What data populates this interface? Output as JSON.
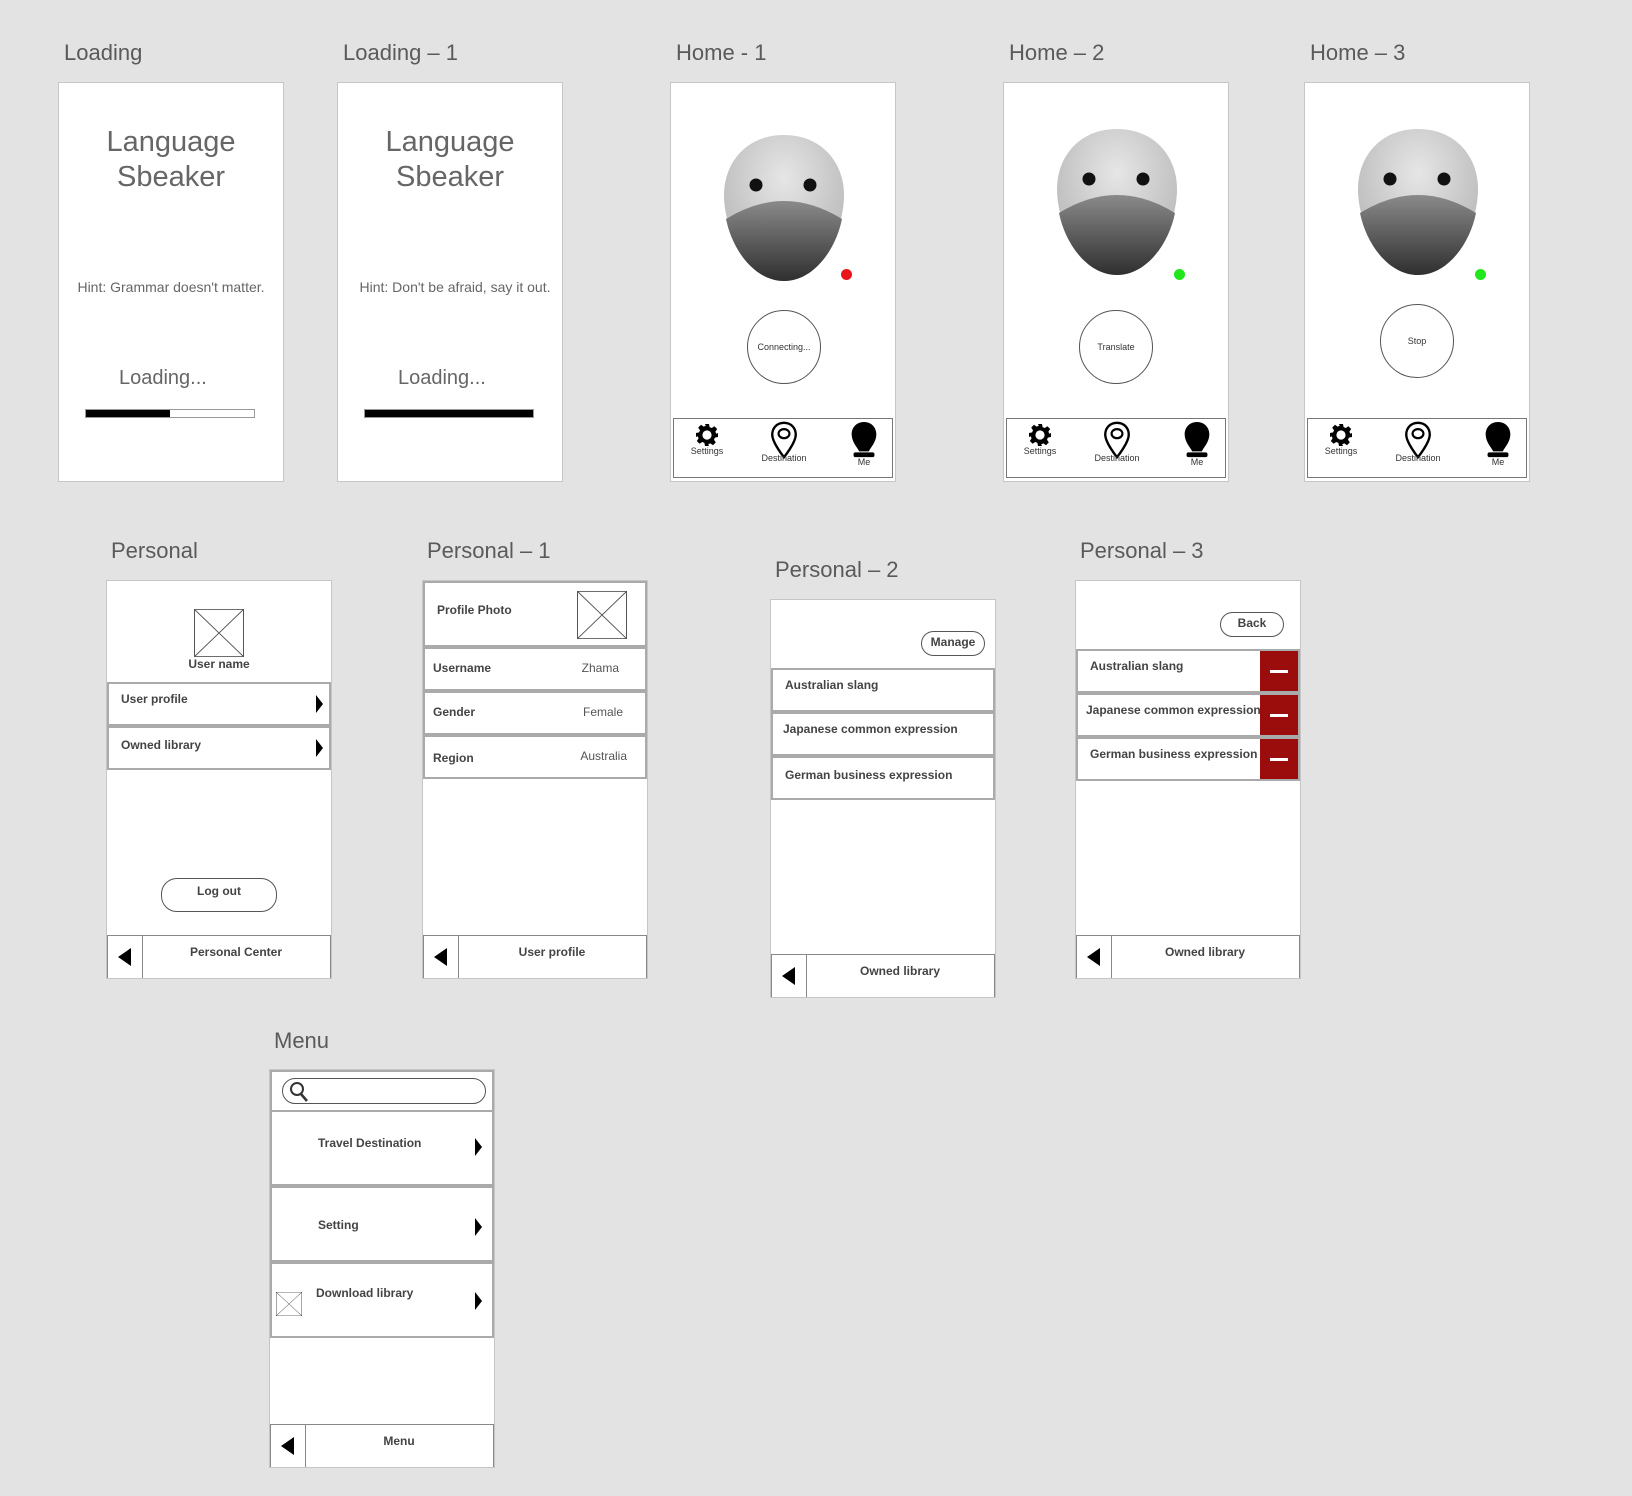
{
  "loading": {
    "label": "Loading",
    "app_title_line1": "Language",
    "app_title_line2": "Sbeaker",
    "hint": "Hint: Grammar doesn't matter.",
    "loading_text": "Loading...",
    "progress": 0.5
  },
  "loading1": {
    "label": "Loading – 1",
    "app_title_line1": "Language",
    "app_title_line2": "Sbeaker",
    "hint": "Hint: Don't be afraid, say it out.",
    "loading_text": "Loading...",
    "progress": 1.0
  },
  "home1": {
    "label": "Home - 1",
    "button": "Connecting...",
    "status_color": "#e8151b",
    "tabs": {
      "settings": "Settings",
      "destination": "Destination",
      "me": "Me"
    }
  },
  "home2": {
    "label": "Home – 2",
    "button": "Translate",
    "status_color": "#22e61c",
    "tabs": {
      "settings": "Settings",
      "destination": "Destination",
      "me": "Me"
    }
  },
  "home3": {
    "label": "Home – 3",
    "button": "Stop",
    "status_color": "#22e61c",
    "tabs": {
      "settings": "Settings",
      "destination": "Destination",
      "me": "Me"
    }
  },
  "personal": {
    "label": "Personal",
    "user_name": "User name",
    "items": [
      "User profile",
      "Owned library"
    ],
    "logout": "Log out",
    "nav_title": "Personal Center"
  },
  "personal1": {
    "label": "Personal – 1",
    "profile_photo": "Profile Photo",
    "fields": [
      {
        "label": "Username",
        "value": "Zhama"
      },
      {
        "label": "Gender",
        "value": "Female"
      },
      {
        "label": "Region",
        "value": "Australia"
      }
    ],
    "nav_title": "User profile"
  },
  "personal2": {
    "label": "Personal – 2",
    "manage": "Manage",
    "items": [
      "Australian slang",
      "Japanese common expression",
      "German business expression"
    ],
    "nav_title": "Owned library"
  },
  "personal3": {
    "label": "Personal – 3",
    "back": "Back",
    "items": [
      "Australian slang",
      "Japanese common expression",
      "German business expression"
    ],
    "nav_title": "Owned library"
  },
  "menu": {
    "label": "Menu",
    "search_placeholder": "",
    "items": [
      "Travel Destination",
      "Setting",
      "Download library"
    ],
    "nav_title": "Menu"
  },
  "colors": {
    "background": "#e3e3e3",
    "delete_red": "#9b0d0d",
    "status_red": "#e8151b",
    "status_green": "#22e61c"
  }
}
